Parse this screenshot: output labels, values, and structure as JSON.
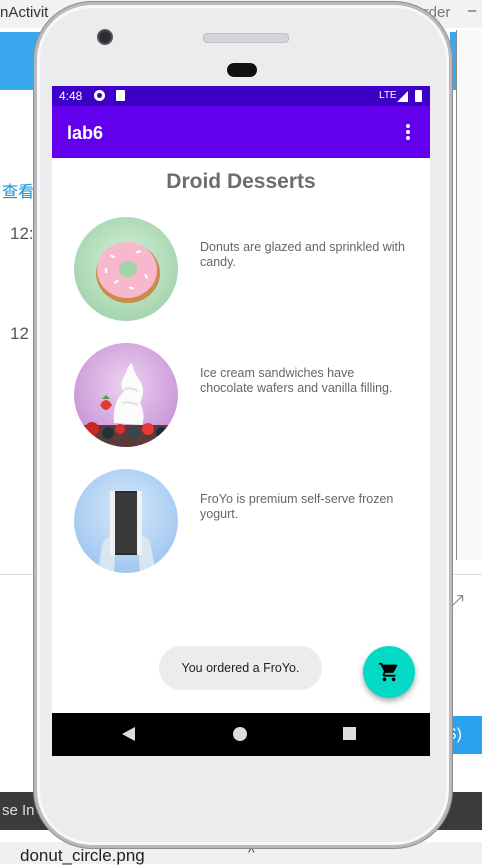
{
  "background": {
    "window_title_left": "nActivit",
    "window_title_right": "Order",
    "minimize_glyph": "–",
    "link_text": "查看",
    "row_numbers": [
      "12:",
      "12"
    ],
    "right_button_label": "S)",
    "dark_bar_text": "se In",
    "bottom_file_tab": "donut_circle.png",
    "bottom_caret": "^"
  },
  "status_bar": {
    "time": "4:48",
    "network": "LTE",
    "color": "#3c00c6"
  },
  "app_bar": {
    "title": "lab6",
    "color": "#6200ee",
    "menu_icon": "overflow-menu-icon"
  },
  "main": {
    "title": "Droid Desserts",
    "desserts": [
      {
        "name": "donut",
        "description": "Donuts are glazed and sprinkled with candy."
      },
      {
        "name": "ice-cream-sandwich",
        "description": "Ice cream sandwiches have chocolate wafers and vanilla filling."
      },
      {
        "name": "froyo",
        "description": "FroYo is premium self-serve frozen yogurt."
      }
    ]
  },
  "toast": {
    "message": "You ordered a FroYo."
  },
  "fab": {
    "icon": "shopping-cart-icon",
    "color": "#03dac5"
  },
  "nav_bar": {
    "back_icon": "back-icon",
    "home_icon": "home-icon",
    "recents_icon": "recents-icon"
  }
}
